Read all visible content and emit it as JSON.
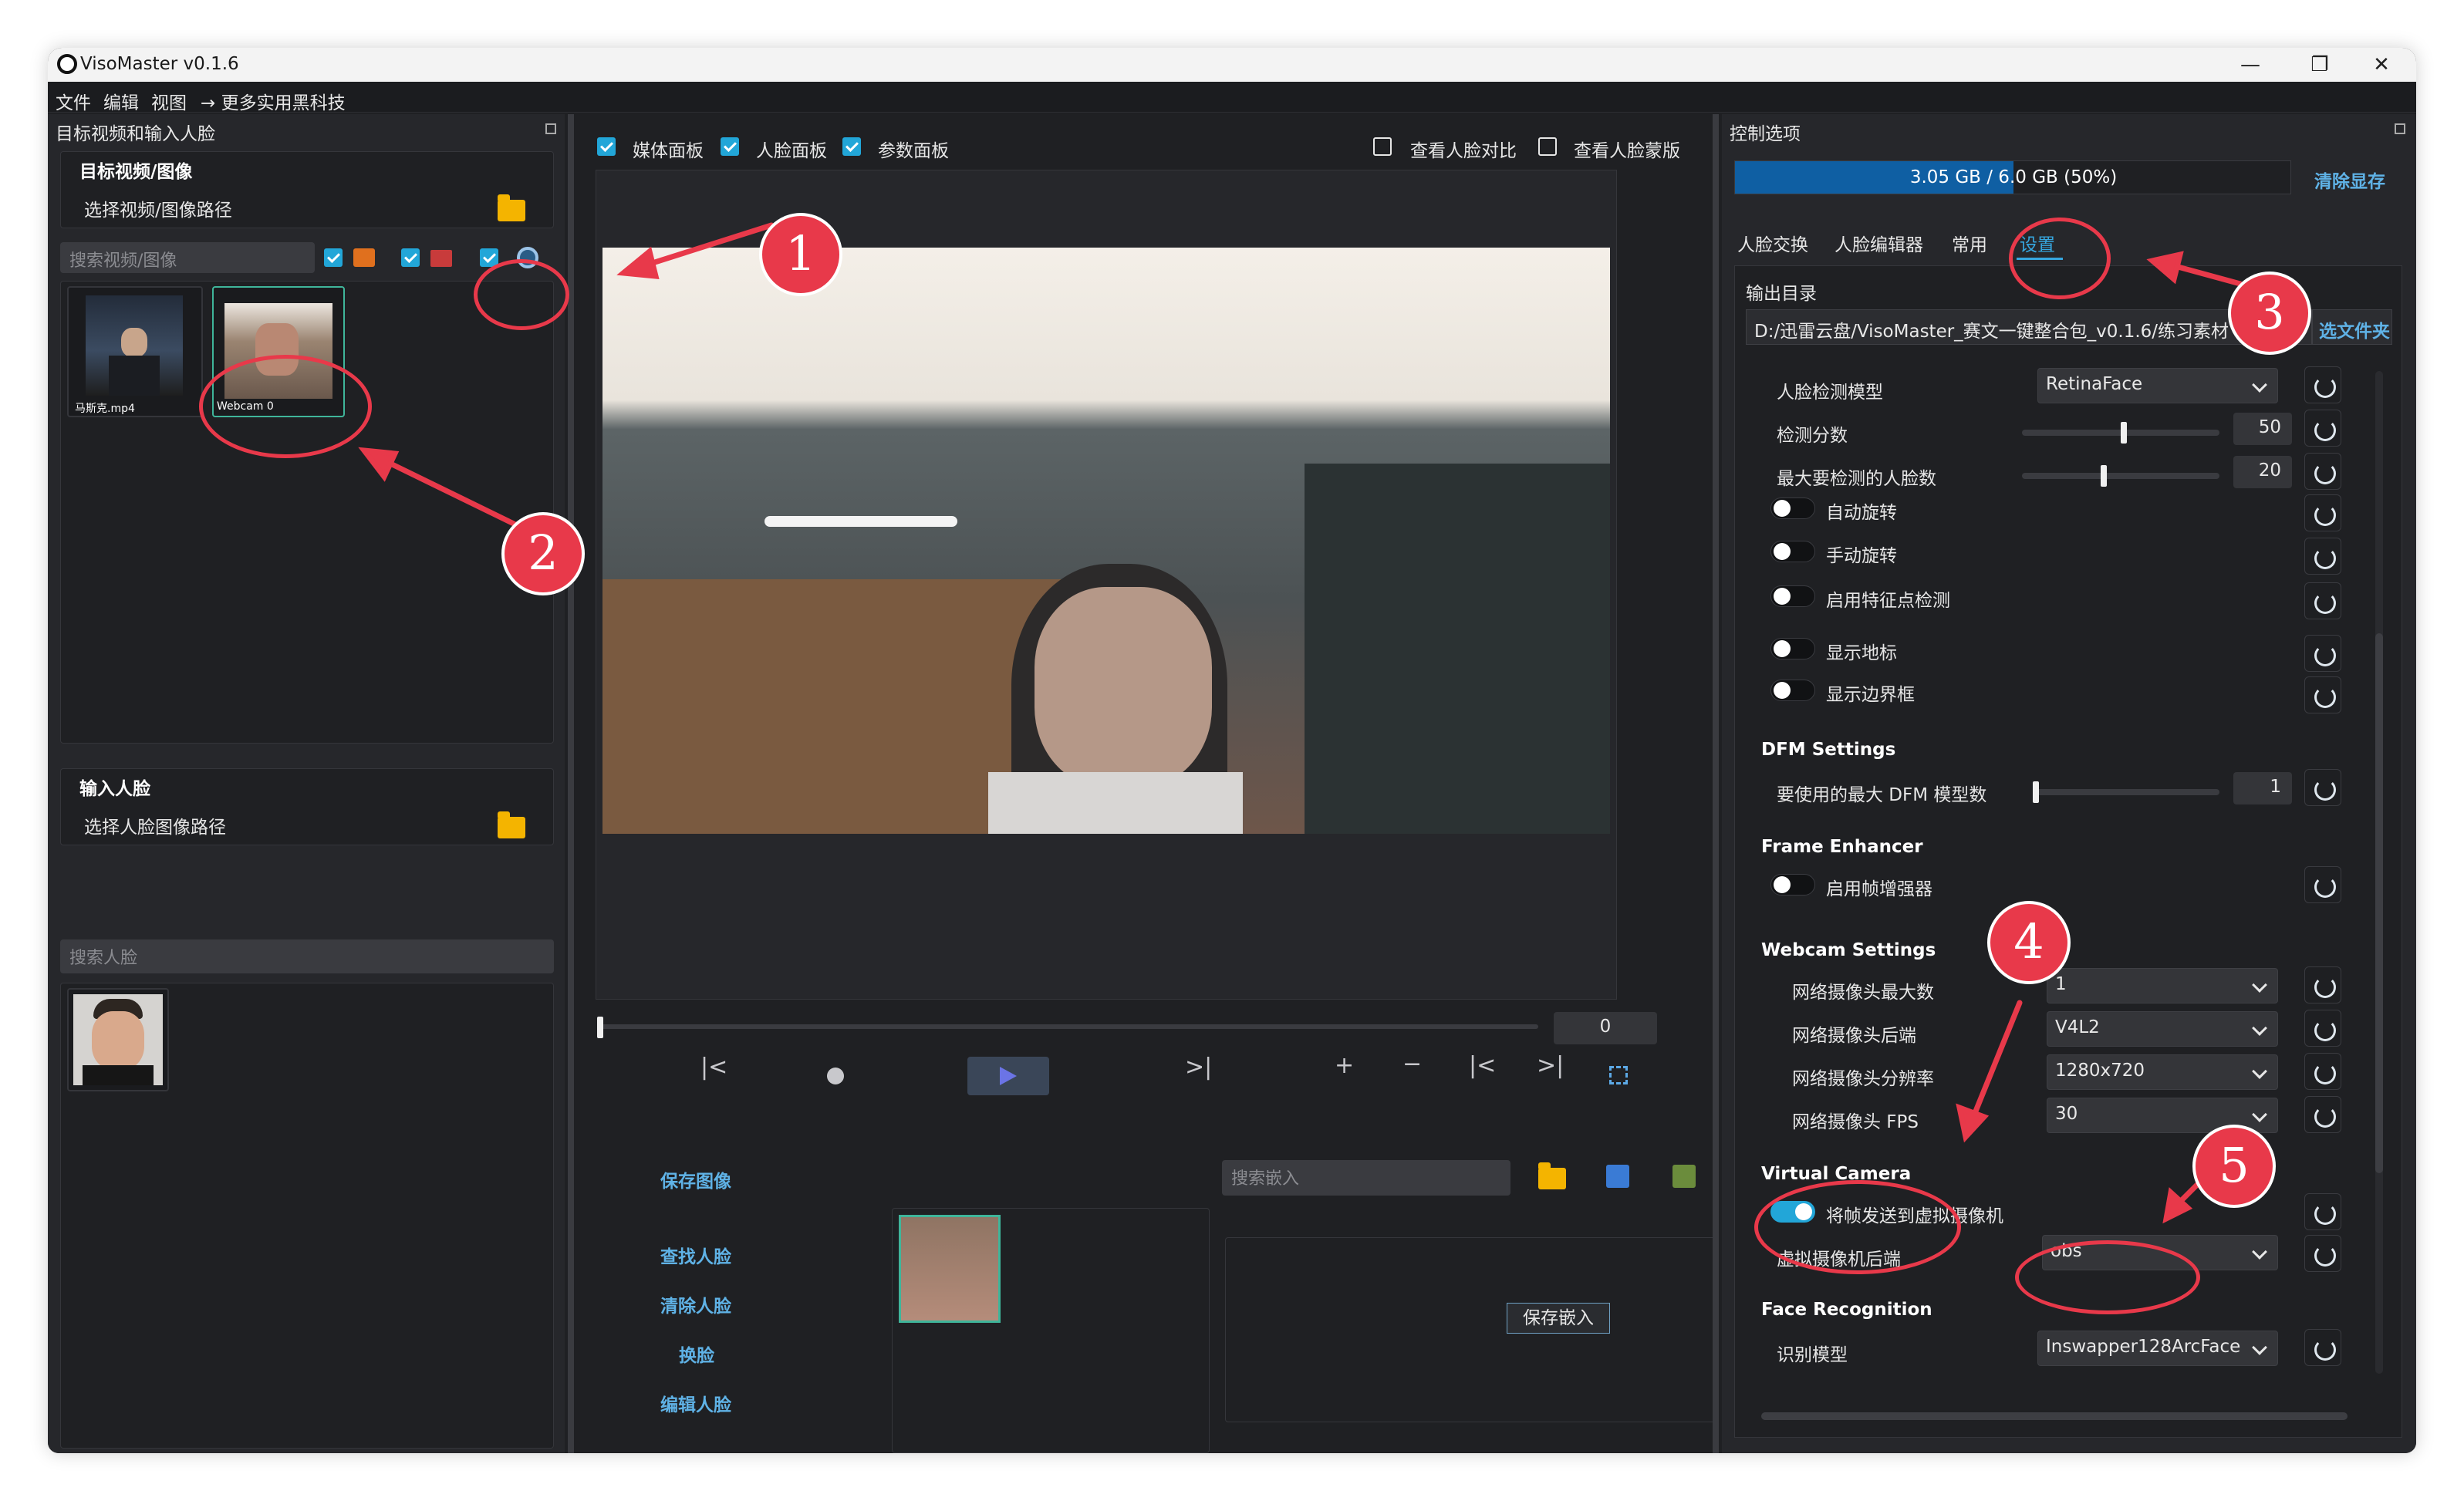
{
  "window": {
    "title": "VisoMaster v0.1.6",
    "minimize": "—",
    "maximize": "❐",
    "close": "✕"
  },
  "menu": [
    "文件",
    "编辑",
    "视图",
    "→ 更多实用黑科技"
  ],
  "left": {
    "panel_title": "目标视频和输入人脸",
    "target_group": "目标视频/图像",
    "select_video_path": "选择视频/图像路径",
    "search_media_placeholder": "搜索视频/图像",
    "thumbs": [
      {
        "label": "马斯克.mp4"
      },
      {
        "label": "Webcam 0"
      }
    ],
    "input_group": "输入人脸",
    "select_face_path": "选择人脸图像路径",
    "search_face_placeholder": "搜索人脸"
  },
  "center": {
    "checks": [
      {
        "label": "媒体面板",
        "checked": true
      },
      {
        "label": "人脸面板",
        "checked": true
      },
      {
        "label": "参数面板",
        "checked": true
      },
      {
        "label": "查看人脸对比",
        "checked": false
      },
      {
        "label": "查看人脸蒙版",
        "checked": false
      }
    ],
    "frame_value": "0",
    "save_image": "保存图像",
    "search_embed_placeholder": "搜索嵌入",
    "actions": [
      "查找人脸",
      "清除人脸",
      "换脸",
      "编辑人脸"
    ],
    "save_embed_button": "保存嵌入"
  },
  "right": {
    "panel_title": "控制选项",
    "vram_text": "3.05 GB / 6.0 GB (50%)",
    "vram_fraction": 0.5,
    "clear_vram": "清除显存",
    "tabs": [
      "人脸交换",
      "人脸编辑器",
      "常用",
      "设置"
    ],
    "active_tab": 3,
    "output_dir_label": "输出目录",
    "output_dir_value": "D:/迅雷云盘/VisoMaster_赛文一键整合包_v0.1.6/练习素材",
    "output_dir_button": "选文件夹",
    "settings": {
      "detect_model_label": "人脸检测模型",
      "detect_model_value": "RetinaFace",
      "detect_score_label": "检测分数",
      "detect_score_value": "50",
      "detect_score_fraction": 0.5,
      "max_faces_label": "最大要检测的人脸数",
      "max_faces_value": "20",
      "max_faces_fraction": 0.4,
      "auto_rotate": "自动旋转",
      "manual_rotate": "手动旋转",
      "landmark_detect": "启用特征点检测",
      "show_landmarks": "显示地标",
      "show_bbox": "显示边界框",
      "dfm_section": "DFM Settings",
      "dfm_max_label": "要使用的最大 DFM 模型数",
      "dfm_max_value": "1",
      "frame_enh_section": "Frame Enhancer",
      "frame_enh_label": "启用帧增强器",
      "webcam_section": "Webcam Settings",
      "webcam_max_label": "网络摄像头最大数",
      "webcam_max_value": "1",
      "webcam_backend_label": "网络摄像头后端",
      "webcam_backend_value": "V4L2",
      "webcam_res_label": "网络摄像头分辨率",
      "webcam_res_value": "1280x720",
      "webcam_fps_label": "网络摄像头 FPS",
      "webcam_fps_value": "30",
      "vcam_section": "Virtual Camera",
      "vcam_send_label": "将帧发送到虚拟摄像机",
      "vcam_backend_label": "虚拟摄像机后端",
      "vcam_backend_value": "obs",
      "face_rec_section": "Face Recognition",
      "rec_model_label": "识别模型",
      "rec_model_value": "Inswapper128ArcFace"
    }
  },
  "annotations": [
    "1",
    "2",
    "3",
    "4",
    "5"
  ],
  "colors": {
    "accent": "#22a6d8",
    "annotation": "#e8394a",
    "highlight": "#3fb59a"
  }
}
